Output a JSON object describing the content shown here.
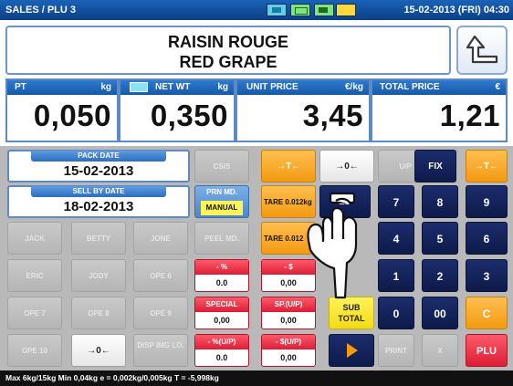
{
  "topbar": {
    "mode": "SALES / PLU 3",
    "datetime": "15-02-2013 (FRI) 04:30"
  },
  "product": {
    "line1": "RAISIN ROUGE",
    "line2": "RED GRAPE"
  },
  "display": {
    "pt": {
      "label": "PT",
      "unit": "kg",
      "value": "0,050"
    },
    "net": {
      "label": "NET WT",
      "unit": "kg",
      "value": "0,350"
    },
    "unit_price": {
      "label": "UNIT PRICE",
      "unit": "€/kg",
      "value": "3,45"
    },
    "total": {
      "label": "TOTAL PRICE",
      "unit": "€",
      "value": "1,21"
    }
  },
  "dates": {
    "pack": {
      "label": "PACK DATE",
      "value": "15-02-2013"
    },
    "sell": {
      "label": "SELL BY DATE",
      "value": "18-02-2013"
    }
  },
  "prn": {
    "label": "PRN MD.",
    "value": "MANUAL"
  },
  "keys": {
    "csis": "CSIS",
    "tare_arrow": "→T←",
    "zero_arrow": "→0←",
    "up": "U/P",
    "fix": "FIX",
    "tare_arrow2": "→T←",
    "tare1": "TARE 0.012kg",
    "ed": "ED",
    "tare2": "TARE 0.012",
    "peel": "PEEL MD.",
    "jack": "JACK",
    "betty": "BETTY",
    "jone": "JONE",
    "eric": "ERIC",
    "jody": "JODY",
    "ope6": "OPE 6",
    "ope7": "OPE 7",
    "ope8": "OPE 8",
    "ope9": "OPE 9",
    "ope10": "OPE 10",
    "zero_arrow2": "→0←",
    "disp_img": "DISP IMG LO.",
    "subtotal": "SUB TOTAL",
    "print": "PRINT",
    "x": "X",
    "plu": "PLU",
    "n7": "7",
    "n8": "8",
    "n9": "9",
    "n4": "4",
    "n5": "5",
    "n6": "6",
    "n1": "1",
    "n2": "2",
    "n3": "3",
    "n0": "0",
    "n00": "00",
    "c": "C"
  },
  "discounts": {
    "pct": {
      "label": "- %",
      "value": "0.0"
    },
    "dollar": {
      "label": "- $",
      "value": "0,00"
    },
    "special": {
      "label": "SPECIAL",
      "value": "0,00"
    },
    "sp_up": {
      "label": "SP.(U/P)",
      "value": "0,00"
    },
    "pct_up": {
      "label": "- %(U/P)",
      "value": "0.0"
    },
    "dollar_up": {
      "label": "- $(U/P)",
      "value": "0,00"
    }
  },
  "status": "Max 6kg/15kg  Min 0,04kg  e = 0,002kg/0,005kg  T = -5,998kg",
  "colors": {
    "accent_blue": "#1a63b7",
    "orange": "#f39a12",
    "red": "#dc1d36",
    "navy": "#0d1a4a"
  },
  "icons": [
    "return-arrow-icon",
    "hand-pointer-icon",
    "play-arrow-icon"
  ]
}
